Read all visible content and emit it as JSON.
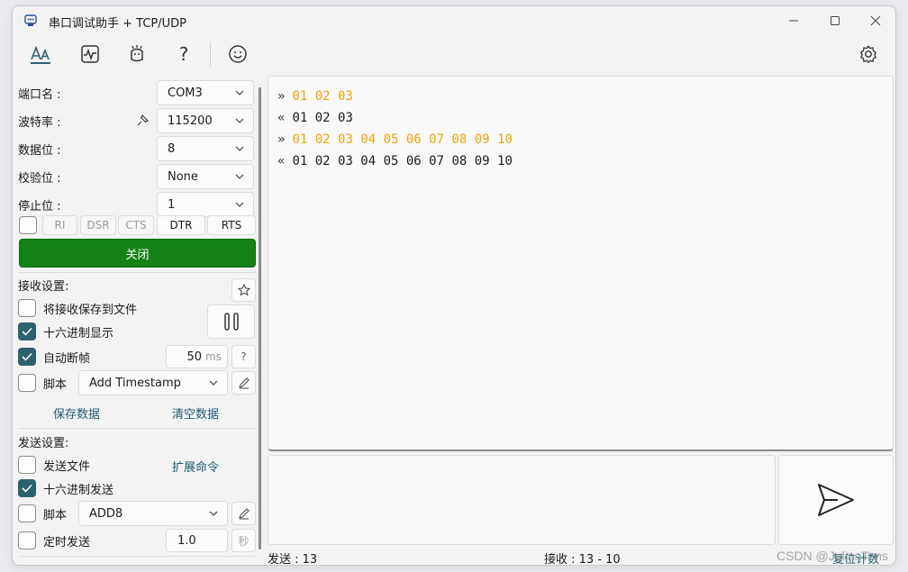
{
  "window": {
    "title": "串口调试助手 + TCP/UDP"
  },
  "toolbar": {
    "icons": [
      "font-icon",
      "waveform-icon",
      "mascot-icon",
      "help-icon",
      "smiley-icon",
      "settings-icon"
    ],
    "help_glyph": "?"
  },
  "port": {
    "port_label": "端口名 :",
    "port_value": "COM3",
    "baud_label": "波特率 :",
    "baud_value": "115200",
    "data_bits_label": "数据位 :",
    "data_bits_value": "8",
    "parity_label": "校验位 :",
    "parity_value": "None",
    "stop_bits_label": "停止位 :",
    "stop_bits_value": "1",
    "signals": [
      "RI",
      "DSR",
      "CTS",
      "DTR",
      "RTS"
    ],
    "close_button": "关闭"
  },
  "receive": {
    "title": "接收设置:",
    "save_to_file": "将接收保存到文件",
    "hex_display": "十六进制显示",
    "auto_frame": "自动断帧",
    "auto_frame_value": "50",
    "auto_frame_unit": "ms",
    "help": "?",
    "script_label": "脚本",
    "script_value": "Add Timestamp",
    "save_data": "保存数据",
    "clear_data": "清空数据",
    "hex_display_checked": true,
    "auto_frame_checked": true
  },
  "send": {
    "title": "发送设置:",
    "send_file": "发送文件",
    "extend_cmd": "扩展命令",
    "hex_send": "十六进制发送",
    "script_label": "脚本",
    "script_value": "ADD8",
    "timed_send": "定时发送",
    "timed_value": "1.0",
    "timed_unit": "秒",
    "hex_send_checked": true
  },
  "log": [
    {
      "dir": "»",
      "type": "tx",
      "data": "01 02 03"
    },
    {
      "dir": "«",
      "type": "rx",
      "data": "01 02 03"
    },
    {
      "dir": "»",
      "type": "tx",
      "data": "01 02 03 04 05 06 07 08 09 10"
    },
    {
      "dir": "«",
      "type": "rx",
      "data": "01 02 03 04 05 06 07 08 09 10"
    }
  ],
  "status": {
    "sent_label": "发送 :",
    "sent_value": "13",
    "recv_label": "接收 :",
    "recv_value": "13  -  10",
    "reset_count": "复位计数"
  },
  "watermark": "CSDN @JulianTans",
  "colors": {
    "tx": "#f0a30a",
    "close_button": "#148214",
    "accent": "#2d6170"
  }
}
